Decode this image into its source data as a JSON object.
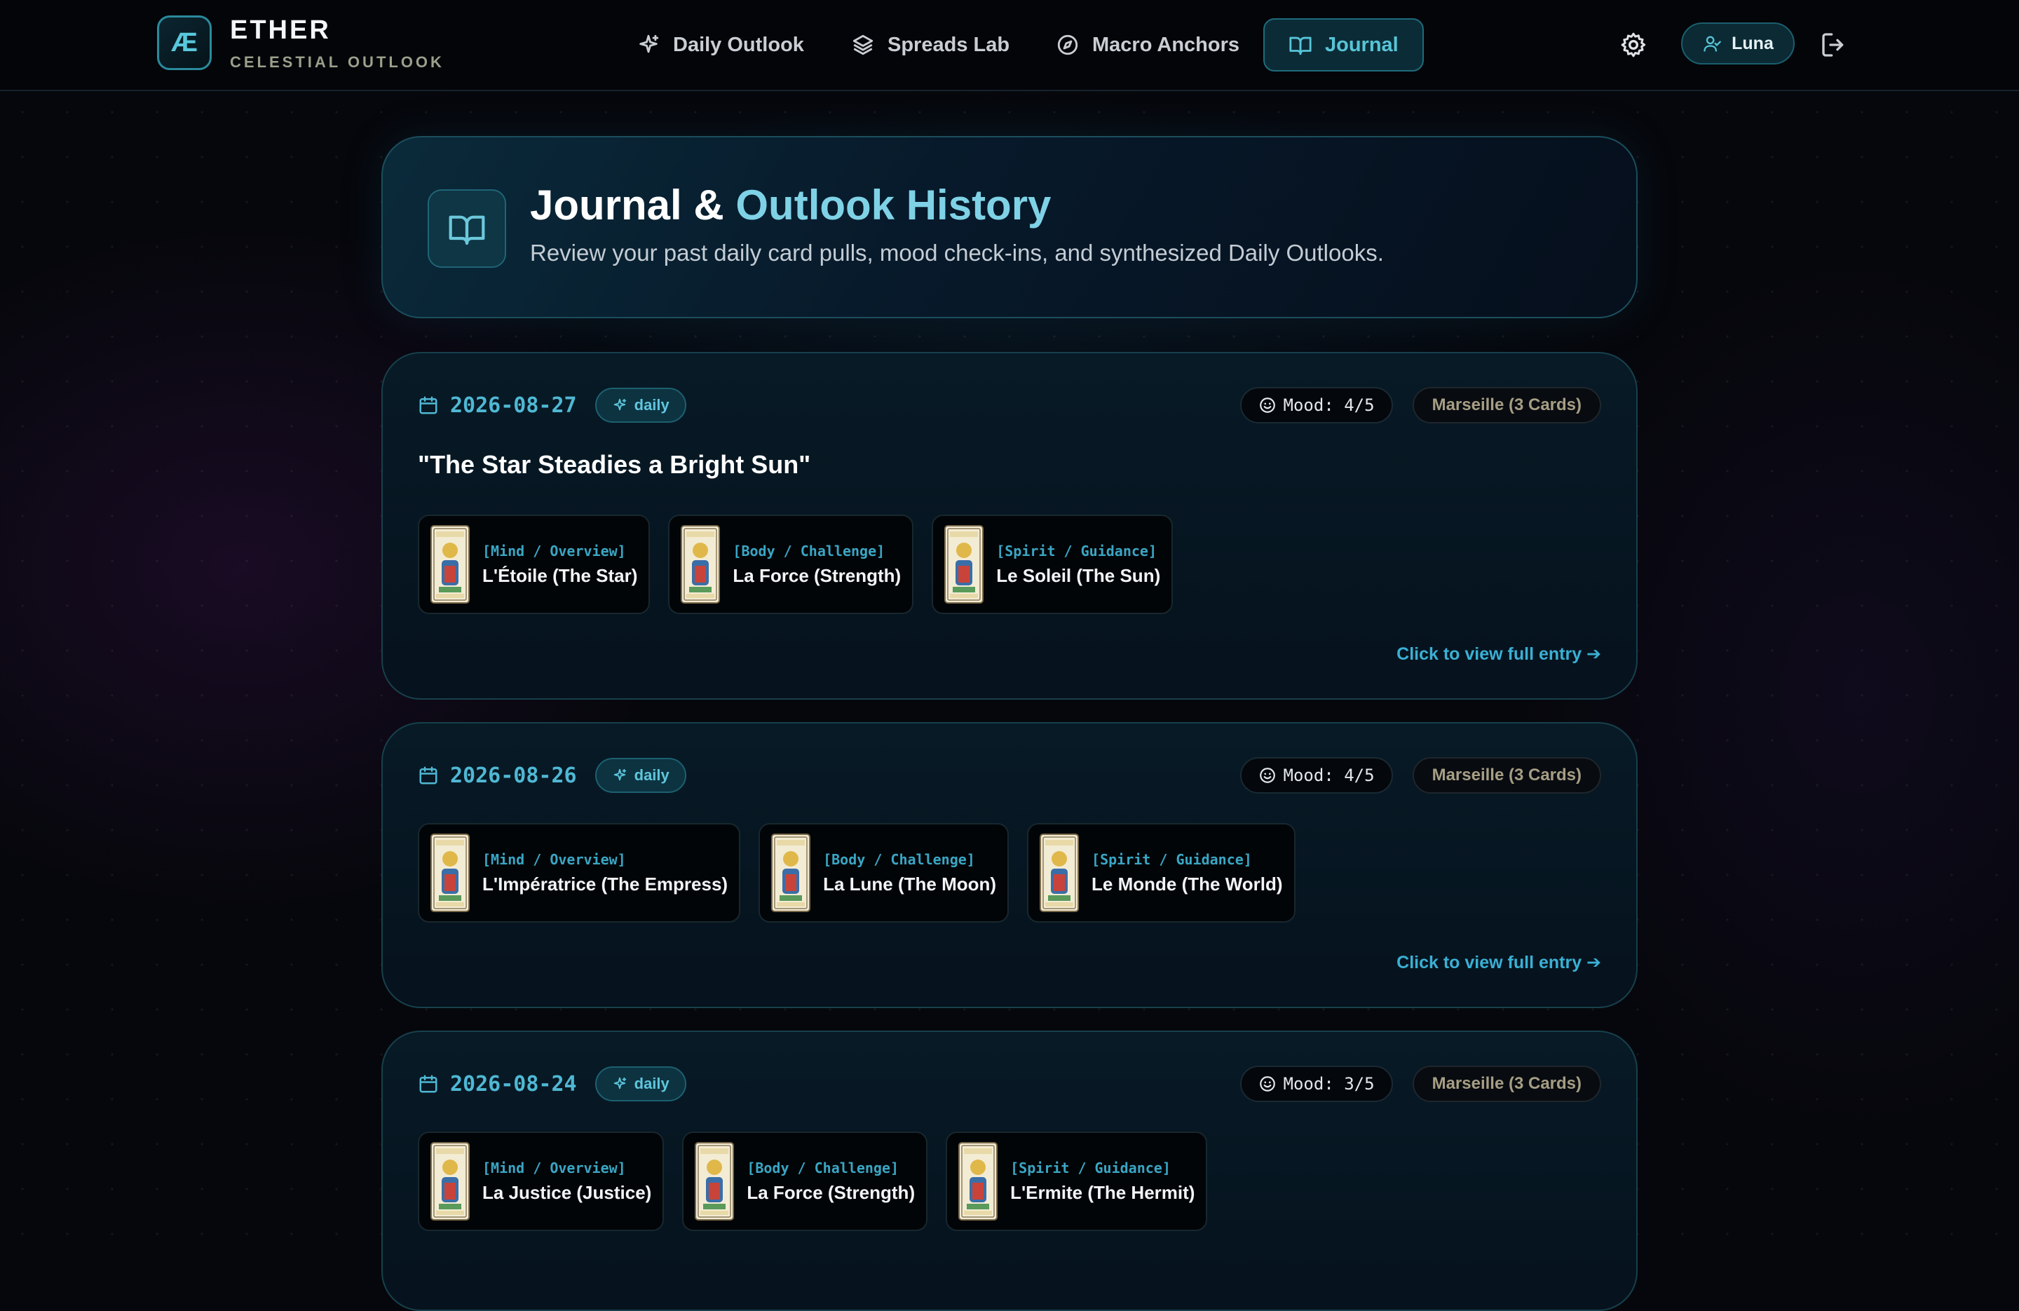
{
  "brand": {
    "logo": "Æ",
    "title": "ETHER",
    "subtitle": "CELESTIAL OUTLOOK"
  },
  "nav": {
    "items": [
      {
        "label": "Daily Outlook",
        "icon": "sparkles-icon"
      },
      {
        "label": "Spreads Lab",
        "icon": "layers-icon"
      },
      {
        "label": "Macro Anchors",
        "icon": "compass-icon"
      },
      {
        "label": "Journal",
        "icon": "book-open-icon",
        "active": true
      }
    ],
    "user": "Luna"
  },
  "hero": {
    "title_main": "Journal & ",
    "title_accent": "Outlook History",
    "subtitle": "Review your past daily card pulls, mood check-ins, and synthesized Daily Outlooks."
  },
  "entries": [
    {
      "date": "2026-08-27",
      "type": "daily",
      "mood": "Mood: 4/5",
      "deck": "Marseille (3 Cards)",
      "title": "\"The Star Steadies a Bright Sun\"",
      "cards": [
        {
          "position": "[Mind / Overview]",
          "name": "L'Étoile (The Star)"
        },
        {
          "position": "[Body / Challenge]",
          "name": "La Force (Strength)"
        },
        {
          "position": "[Spirit / Guidance]",
          "name": "Le Soleil (The Sun)"
        }
      ],
      "link": "Click to view full entry ➔"
    },
    {
      "date": "2026-08-26",
      "type": "daily",
      "mood": "Mood: 4/5",
      "deck": "Marseille (3 Cards)",
      "cards": [
        {
          "position": "[Mind / Overview]",
          "name": "L'Impératrice (The Empress)"
        },
        {
          "position": "[Body / Challenge]",
          "name": "La Lune (The Moon)"
        },
        {
          "position": "[Spirit / Guidance]",
          "name": "Le Monde (The World)"
        }
      ],
      "link": "Click to view full entry ➔"
    },
    {
      "date": "2026-08-24",
      "type": "daily",
      "mood": "Mood: 3/5",
      "deck": "Marseille (3 Cards)",
      "cards": [
        {
          "position": "[Mind / Overview]",
          "name": "La Justice (Justice)"
        },
        {
          "position": "[Body / Challenge]",
          "name": "La Force (Strength)"
        },
        {
          "position": "[Spirit / Guidance]",
          "name": "L'Ermite (The Hermit)"
        }
      ]
    }
  ],
  "colors": {
    "accent": "#58c4d8",
    "background": "#06070c",
    "deck_text": "#a69e84"
  }
}
